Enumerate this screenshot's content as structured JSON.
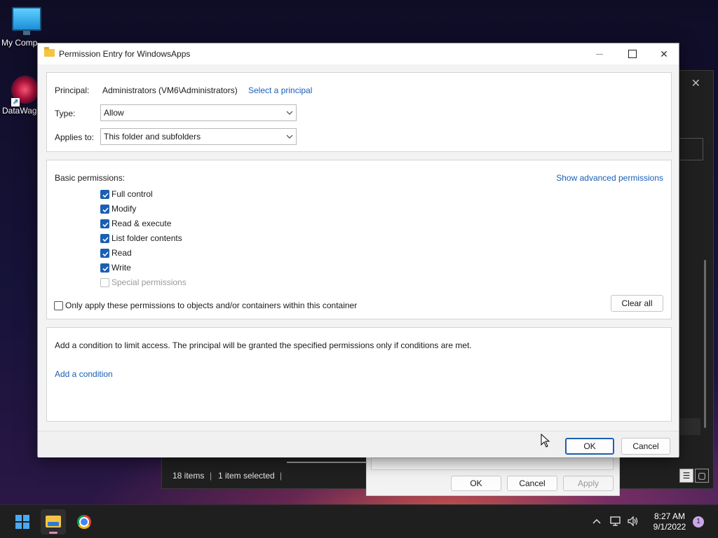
{
  "desktop": {
    "icons": [
      {
        "label": "My Comp"
      },
      {
        "label": "DataWago"
      }
    ]
  },
  "explorer": {
    "status_items": "18 items",
    "status_selected": "1 item selected",
    "separator": "|"
  },
  "properties": {
    "ok_label": "OK",
    "cancel_label": "Cancel",
    "apply_label": "Apply"
  },
  "dialog": {
    "title": "Permission Entry for WindowsApps",
    "principal_label": "Principal:",
    "principal_value": "Administrators (VM6\\Administrators)",
    "select_principal_link": "Select a principal",
    "type_label": "Type:",
    "type_value": "Allow",
    "applies_label": "Applies to:",
    "applies_value": "This folder and subfolders",
    "basic_permissions_label": "Basic permissions:",
    "show_advanced_link": "Show advanced permissions",
    "permissions": [
      {
        "label": "Full control",
        "checked": true
      },
      {
        "label": "Modify",
        "checked": true
      },
      {
        "label": "Read & execute",
        "checked": true
      },
      {
        "label": "List folder contents",
        "checked": true
      },
      {
        "label": "Read",
        "checked": true
      },
      {
        "label": "Write",
        "checked": true
      },
      {
        "label": "Special permissions",
        "checked": false,
        "disabled": true
      }
    ],
    "only_apply_label": "Only apply these permissions to objects and/or containers within this container",
    "clear_all_label": "Clear all",
    "condition_text": "Add a condition to limit access. The principal will be granted the specified permissions only if conditions are met.",
    "add_condition_link": "Add a condition",
    "ok_label": "OK",
    "cancel_label": "Cancel"
  },
  "taskbar": {
    "time": "8:27 AM",
    "date": "9/1/2022",
    "notification_count": "1"
  },
  "colors": {
    "accent": "#1a5fb4",
    "dialog_bg": "#f3f3f3",
    "taskbar_bg": "#1f1f1f"
  }
}
